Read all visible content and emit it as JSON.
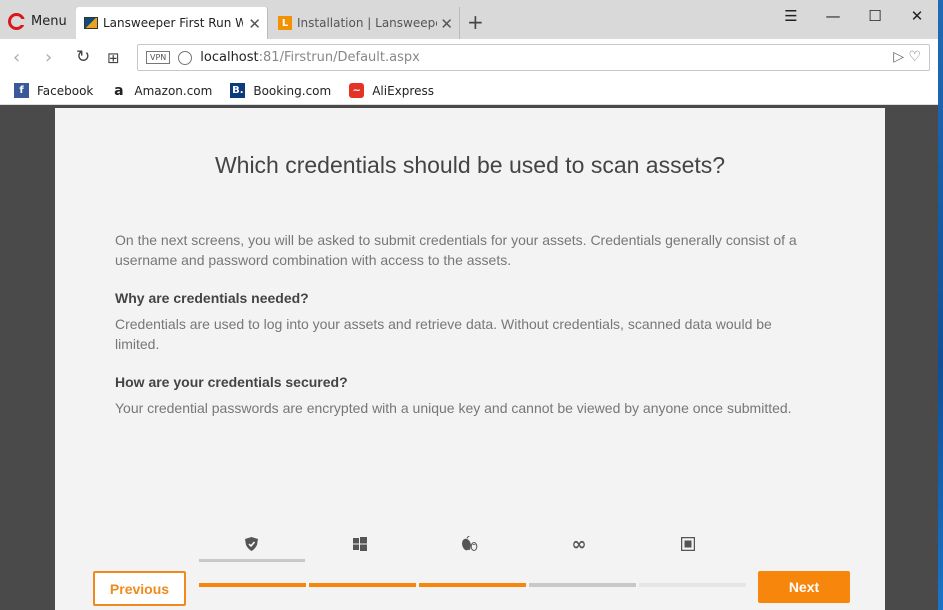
{
  "browser": {
    "menu_label": "Menu",
    "tabs": [
      {
        "title": "Lansweeper First Run Wiza"
      },
      {
        "title": "Installation | Lansweeper I"
      }
    ],
    "url": {
      "vpn_badge": "VPN",
      "host": "localhost",
      "rest": ":81/Firstrun/Default.aspx"
    },
    "bookmarks": [
      {
        "label": "Facebook",
        "icon": "f",
        "color": "#3b5998"
      },
      {
        "label": "Amazon.com",
        "icon": "a",
        "color": "#222222"
      },
      {
        "label": "Booking.com",
        "icon": "B.",
        "color": "#0c3b7c"
      },
      {
        "label": "AliExpress",
        "icon": "~",
        "color": "#e43225"
      }
    ]
  },
  "wizard": {
    "title": "Which credentials should be used to scan assets?",
    "intro": "On the next screens, you will be asked to submit credentials for your assets. Credentials generally consist of a username and password combination with access to the assets.",
    "sections": [
      {
        "heading": "Why are credentials needed?",
        "body": "Credentials are used to log into your assets and retrieve data. Without credentials, scanned data would be limited."
      },
      {
        "heading": "How are your credentials secured?",
        "body": "Your credential passwords are encrypted with a unique key and cannot be viewed by anyone once submitted."
      }
    ],
    "steps": [
      "shield-icon",
      "windows-icon",
      "apple-linux-icon",
      "infinity-icon",
      "square-icon"
    ],
    "progress_colors": [
      "#f7860c",
      "#f7860c",
      "#f7860c",
      "#c8c8c8",
      "#e6e6e6"
    ],
    "previous_label": "Previous",
    "next_label": "Next"
  }
}
